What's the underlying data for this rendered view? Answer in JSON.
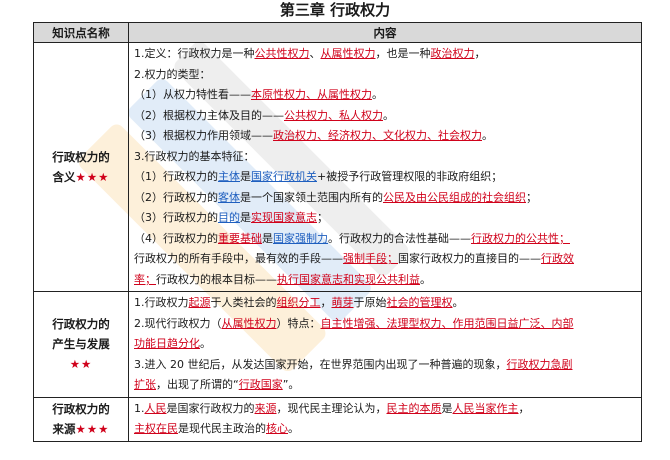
{
  "page": {
    "title": "第三章  行政权力"
  },
  "table": {
    "headers": [
      "知识点名称",
      "内容"
    ],
    "rows": [
      {
        "name": "行政权力的含义",
        "stars": "★★★",
        "lines": [
          [
            {
              "t": "1.定义：行政权力是一种"
            },
            {
              "t": "公共性权力",
              "s": "u"
            },
            {
              "t": "、"
            },
            {
              "t": "从属性权力",
              "s": "u"
            },
            {
              "t": "，也是一种"
            },
            {
              "t": "政治权力",
              "s": "u"
            },
            {
              "t": "，"
            }
          ],
          [
            {
              "t": "2.权力的类型："
            }
          ],
          [
            {
              "t": "（1）从权力特性看——"
            },
            {
              "t": "本原性权力、从属性权力",
              "s": "u"
            },
            {
              "t": "。"
            }
          ],
          [
            {
              "t": "（2）根据权力主体及目的——"
            },
            {
              "t": "公共权力、私人权力",
              "s": "u"
            },
            {
              "t": "。"
            }
          ],
          [
            {
              "t": "（3）根据权力作用领域——"
            },
            {
              "t": "政治权力、经济权力、文化权力、社会权力",
              "s": "u"
            },
            {
              "t": "。"
            }
          ],
          [
            {
              "t": "3.行政权力的基本特征："
            }
          ],
          [
            {
              "t": "（1）行政权力的"
            },
            {
              "t": "主体",
              "s": "b"
            },
            {
              "t": "是"
            },
            {
              "t": "国家行政机关",
              "s": "b"
            },
            {
              "t": "+被授予行政管理权限的非政府组织；"
            }
          ],
          [
            {
              "t": "（2）行政权力的"
            },
            {
              "t": "客体",
              "s": "b"
            },
            {
              "t": "是一个国家领土范围内所有的"
            },
            {
              "t": "公民及由公民组成的社会组织",
              "s": "u"
            },
            {
              "t": "；"
            }
          ],
          [
            {
              "t": "（3）行政权力的"
            },
            {
              "t": "目的",
              "s": "b"
            },
            {
              "t": "是"
            },
            {
              "t": "实现国家意志",
              "s": "u"
            },
            {
              "t": "；"
            }
          ],
          [
            {
              "t": "（4）行政权力的"
            },
            {
              "t": "重要基础",
              "s": "u"
            },
            {
              "t": "是"
            },
            {
              "t": "国家强制力",
              "s": "b"
            },
            {
              "t": "。行政权力的合法性基础——"
            },
            {
              "t": "行政权力的公共性；",
              "s": "u"
            }
          ],
          [
            {
              "t": "行政权力的所有手段中，最有效的手段——"
            },
            {
              "t": "强制手段；",
              "s": "u"
            },
            {
              "t": "国家行政权力的直接目的——"
            },
            {
              "t": "行政效",
              "s": "u"
            }
          ],
          [
            {
              "t": "率；",
              "s": "u"
            },
            {
              "t": "行政权力的根本目标——"
            },
            {
              "t": "执行国家意志和实现公共利益",
              "s": "u"
            },
            {
              "t": "。"
            }
          ]
        ]
      },
      {
        "name": "行政权力的产生与发展",
        "stars": "★★",
        "lines": [
          [
            {
              "t": "1.行政权力"
            },
            {
              "t": "起源",
              "s": "u"
            },
            {
              "t": "于人类社会的"
            },
            {
              "t": "组织分工",
              "s": "u"
            },
            {
              "t": "，"
            },
            {
              "t": "萌芽",
              "s": "u"
            },
            {
              "t": "于原始"
            },
            {
              "t": "社会的管理权",
              "s": "u"
            },
            {
              "t": "。"
            }
          ],
          [
            {
              "t": "2.现代行政权力（"
            },
            {
              "t": "从属性权力",
              "s": "u"
            },
            {
              "t": "）特点："
            },
            {
              "t": "自主性增强、法理型权力、作用范围日益广泛、内部",
              "s": "u"
            }
          ],
          [
            {
              "t": "功能日趋分化",
              "s": "u"
            },
            {
              "t": "。"
            }
          ],
          [
            {
              "t": "3.进入 20 世纪后，从发达国家开始，在世界范围内出现了一种普遍的现象，"
            },
            {
              "t": "行政权力急剧",
              "s": "u"
            }
          ],
          [
            {
              "t": "扩张",
              "s": "u"
            },
            {
              "t": "，出现了所谓的“"
            },
            {
              "t": "行政国家",
              "s": "u"
            },
            {
              "t": "”。"
            }
          ]
        ]
      },
      {
        "name": "行政权力的来源",
        "stars": "★★★",
        "lines": [
          [
            {
              "t": "1."
            },
            {
              "t": "人民",
              "s": "u"
            },
            {
              "t": "是国家行政权力的"
            },
            {
              "t": "来源",
              "s": "u"
            },
            {
              "t": "，现代民主理论认为，"
            },
            {
              "t": "民主的本质",
              "s": "u"
            },
            {
              "t": "是"
            },
            {
              "t": "人民当家作主",
              "s": "u"
            },
            {
              "t": "，"
            }
          ],
          [
            {
              "t": "主权在民",
              "s": "u"
            },
            {
              "t": "是现代民主政治的"
            },
            {
              "t": "核心",
              "s": "u"
            },
            {
              "t": "。"
            }
          ]
        ]
      }
    ]
  }
}
